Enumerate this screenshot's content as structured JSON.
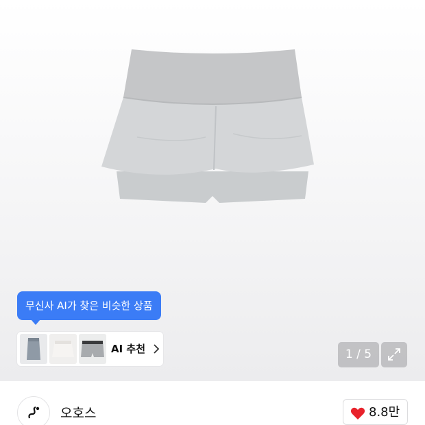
{
  "image_counter": "1 / 5",
  "ai_tooltip": "무신사 AI가 찾은 비슷한 상품",
  "ai_recommend_label": "AI 추천",
  "brand_name": "오호스",
  "like_count": "8.8만",
  "colors": {
    "accent_blue": "#3b7cf6",
    "heart_red": "#e8222b"
  },
  "icons": {
    "expand": "expand-icon",
    "chevron": "chevron-right-icon",
    "heart": "heart-icon",
    "logo": "brand-logo-icon"
  }
}
